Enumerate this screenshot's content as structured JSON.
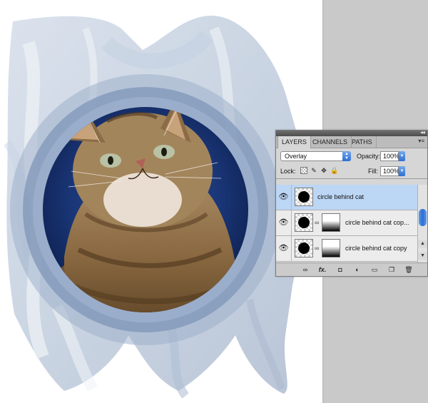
{
  "panel": {
    "tabs": [
      {
        "label": "LAYERS",
        "active": true
      },
      {
        "label": "CHANNELS",
        "active": false
      },
      {
        "label": "PATHS",
        "active": false
      }
    ],
    "blend_mode": "Overlay",
    "opacity_label": "Opacity:",
    "opacity_value": "100%",
    "lock_label": "Lock:",
    "fill_label": "Fill:",
    "fill_value": "100%",
    "layers": [
      {
        "name": "circle behind cat",
        "selected": true,
        "has_mask": false
      },
      {
        "name": "circle behind cat cop...",
        "selected": false,
        "has_mask": true
      },
      {
        "name": "circle behind cat copy",
        "selected": false,
        "has_mask": true
      }
    ],
    "footer_fx_label": "fx."
  },
  "colors": {
    "selected_row": "#bcd6f5",
    "accent_blue": "#2f6fd6",
    "canvas_gray": "#c9c9c9"
  }
}
